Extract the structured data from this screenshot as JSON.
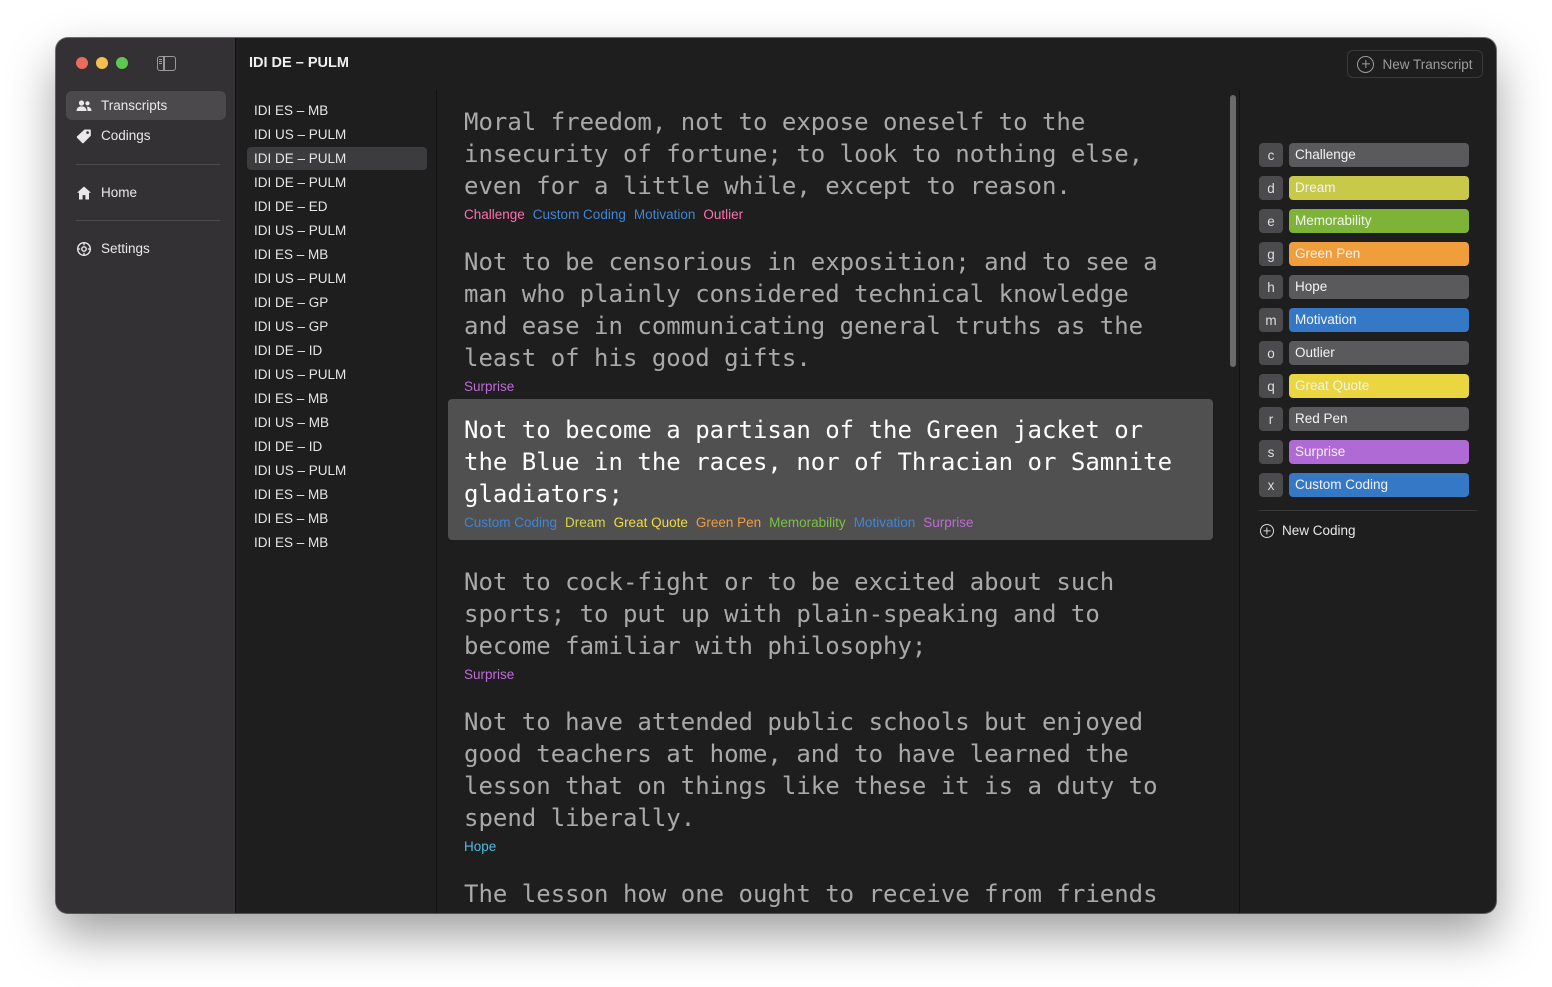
{
  "window": {
    "title": "IDI DE – PULM"
  },
  "sidebar": {
    "items": [
      {
        "label": "Transcripts",
        "icon": "people-icon",
        "active": true
      },
      {
        "label": "Codings",
        "icon": "tag-icon",
        "active": false
      },
      {
        "label": "Home",
        "icon": "house-icon",
        "active": false
      },
      {
        "label": "Settings",
        "icon": "gear-icon",
        "active": false
      }
    ]
  },
  "toolbar": {
    "new_transcript_label": "New Transcript"
  },
  "transcripts": [
    "IDI ES – MB",
    "IDI US – PULM",
    "IDI DE – PULM",
    "IDI DE – PULM",
    "IDI DE – ED",
    "IDI US – PULM",
    "IDI ES – MB",
    "IDI US – PULM",
    "IDI DE – GP",
    "IDI US – GP",
    "IDI DE – ID",
    "IDI US – PULM",
    "IDI ES – MB",
    "IDI US – MB",
    "IDI DE – ID",
    "IDI US – PULM",
    "IDI ES – MB",
    "IDI ES – MB",
    "IDI ES – MB"
  ],
  "selected_transcript_index": 2,
  "paragraphs": [
    {
      "text": "Moral freedom, not to expose oneself to the\ninsecurity of fortune; to look to nothing else,\neven for a little while, except to reason.",
      "tags": [
        {
          "label": "Challenge",
          "color": "#ff6fb0"
        },
        {
          "label": "Custom Coding",
          "color": "#3f86d8"
        },
        {
          "label": "Motivation",
          "color": "#3f86d8"
        },
        {
          "label": "Outlier",
          "color": "#ff6fb0"
        }
      ]
    },
    {
      "text": "Not to be censorious in exposition; and to see a\nman who plainly considered technical knowledge\nand ease in communicating general truths as the\nleast of his good gifts.",
      "tags": [
        {
          "label": "Surprise",
          "color": "#bf6bd9"
        }
      ]
    },
    {
      "text": "Not to become a partisan of the Green jacket or\nthe Blue in the races, nor of Thracian or Samnite\ngladiators;",
      "selected": true,
      "tags": [
        {
          "label": "Custom Coding",
          "color": "#3f86d8"
        },
        {
          "label": "Dream",
          "color": "#d5d646"
        },
        {
          "label": "Great Quote",
          "color": "#f2db3e"
        },
        {
          "label": "Green Pen",
          "color": "#f09d3b"
        },
        {
          "label": "Memorability",
          "color": "#7bc242"
        },
        {
          "label": "Motivation",
          "color": "#3f86d8"
        },
        {
          "label": "Surprise",
          "color": "#bf6bd9"
        }
      ]
    },
    {
      "text": "Not to cock-fight or to be excited about such\nsports; to put up with plain-speaking and to\nbecome familiar with philosophy;",
      "tags": [
        {
          "label": "Surprise",
          "color": "#bf6bd9"
        }
      ]
    },
    {
      "text": "Not to have attended public schools but enjoyed\ngood teachers at home, and to have learned the\nlesson that on things like these it is a duty to\nspend liberally.",
      "tags": [
        {
          "label": "Hope",
          "color": "#4dbde3"
        }
      ]
    },
    {
      "text": "The lesson how one ought to receive from friends",
      "tags": []
    }
  ],
  "codings": [
    {
      "key": "c",
      "label": "Challenge",
      "color": "#5a595b"
    },
    {
      "key": "d",
      "label": "Dream",
      "color": "#c8c849"
    },
    {
      "key": "e",
      "label": "Memorability",
      "color": "#7db437"
    },
    {
      "key": "g",
      "label": "Green Pen",
      "color": "#f09d3b"
    },
    {
      "key": "h",
      "label": "Hope",
      "color": "#5a595b"
    },
    {
      "key": "m",
      "label": "Motivation",
      "color": "#3478c6"
    },
    {
      "key": "o",
      "label": "Outlier",
      "color": "#5a595b"
    },
    {
      "key": "q",
      "label": "Great Quote",
      "color": "#e9d641"
    },
    {
      "key": "r",
      "label": "Red Pen",
      "color": "#5a595b"
    },
    {
      "key": "s",
      "label": "Surprise",
      "color": "#b06ad6"
    },
    {
      "key": "x",
      "label": "Custom Coding",
      "color": "#3478c6"
    }
  ],
  "new_coding_label": "New Coding"
}
